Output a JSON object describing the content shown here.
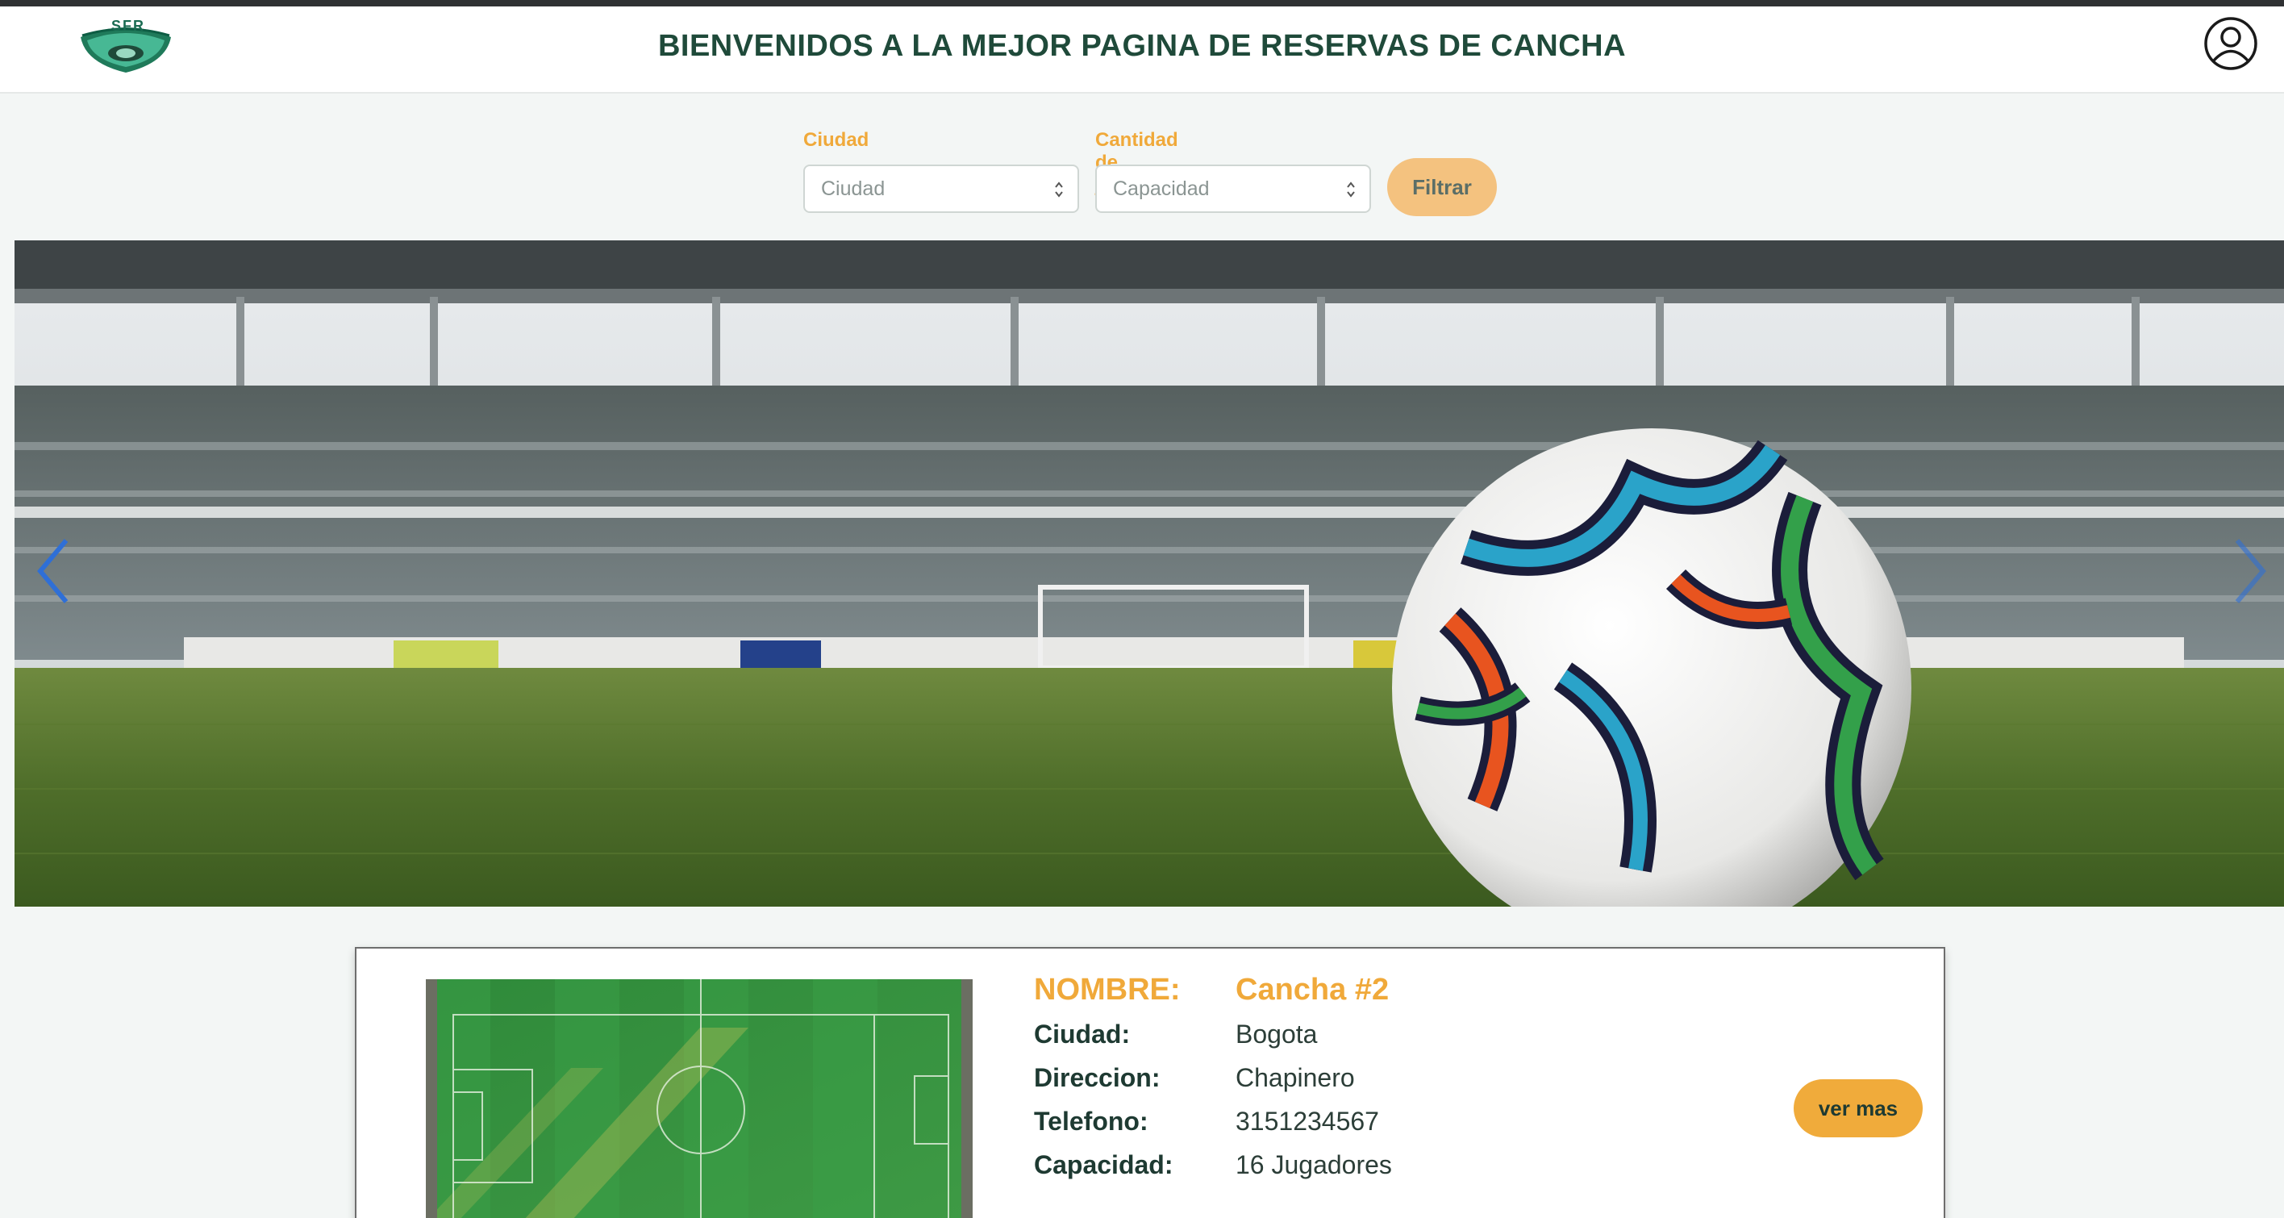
{
  "header": {
    "logo_text": "SFR",
    "title": "BIENVENIDOS A LA MEJOR PAGINA DE RESERVAS DE CANCHA"
  },
  "filters": {
    "city_label": "Ciudad",
    "city_value": "Ciudad",
    "players_label": "Cantidad de jugadores",
    "players_value": "Capacidad",
    "filter_button": "Filtrar"
  },
  "carousel": {
    "image": "stadium-football-icon"
  },
  "card": {
    "image": "field-aerial-icon",
    "name_key": "NOMBRE:",
    "name_value": "Cancha #2",
    "city_key": "Ciudad:",
    "city_value": "Bogota",
    "address_key": "Direccion:",
    "address_value": "Chapinero",
    "phone_key": "Telefono:",
    "phone_value": "3151234567",
    "capacity_key": "Capacidad:",
    "capacity_value": "16 Jugadores",
    "more_button": "ver mas"
  },
  "colors": {
    "accent": "#f0a93a",
    "title": "#1f4a3a",
    "background": "#f3f6f5"
  }
}
